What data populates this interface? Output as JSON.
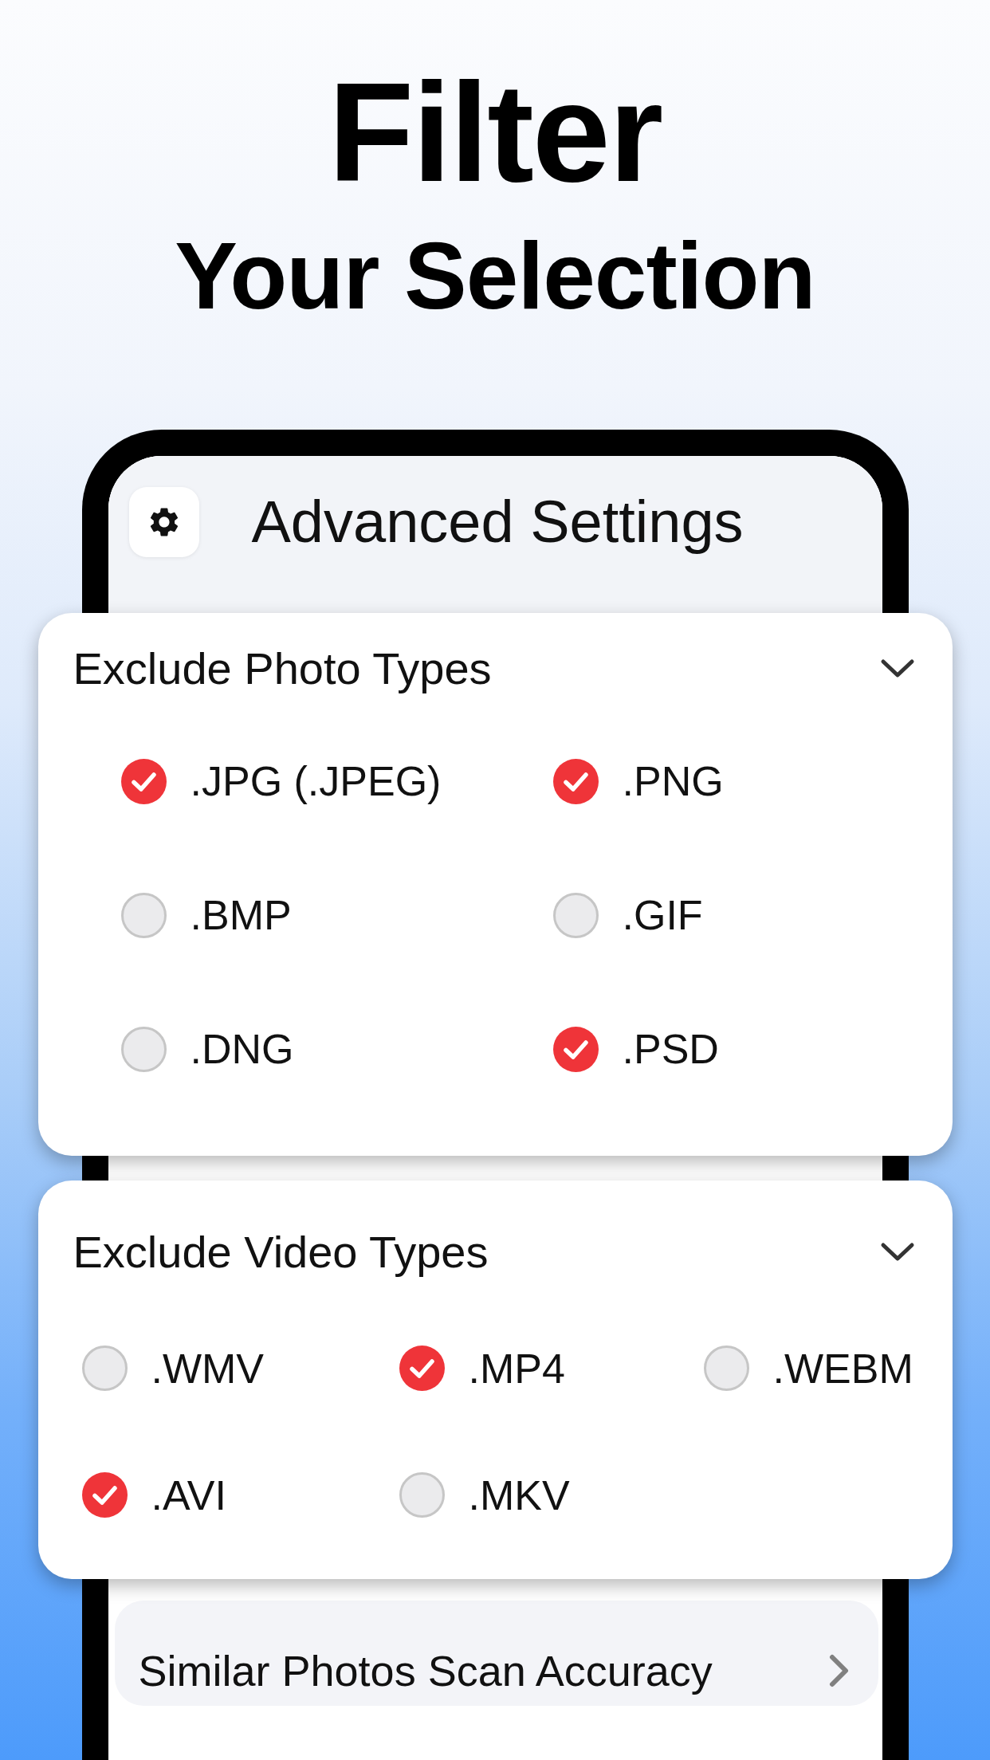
{
  "headline": {
    "title": "Filter",
    "subtitle": "Your Selection"
  },
  "screen": {
    "header": {
      "title": "Advanced Settings"
    },
    "sections": [
      {
        "title": "Exclude Photo Types",
        "expanded": true,
        "options": [
          {
            "label": ".JPG (.JPEG)",
            "checked": true
          },
          {
            "label": ".PNG",
            "checked": true
          },
          {
            "label": ".BMP",
            "checked": false
          },
          {
            "label": ".GIF",
            "checked": false
          },
          {
            "label": ".DNG",
            "checked": false
          },
          {
            "label": ".PSD",
            "checked": true
          }
        ]
      },
      {
        "title": "Exclude Video Types",
        "expanded": true,
        "options": [
          {
            "label": ".WMV",
            "checked": false
          },
          {
            "label": ".MP4",
            "checked": true
          },
          {
            "label": ".WEBM",
            "checked": false
          },
          {
            "label": ".AVI",
            "checked": true
          },
          {
            "label": ".MKV",
            "checked": false
          }
        ]
      }
    ],
    "menu_item": {
      "label": "Similar Photos Scan Accuracy"
    }
  }
}
